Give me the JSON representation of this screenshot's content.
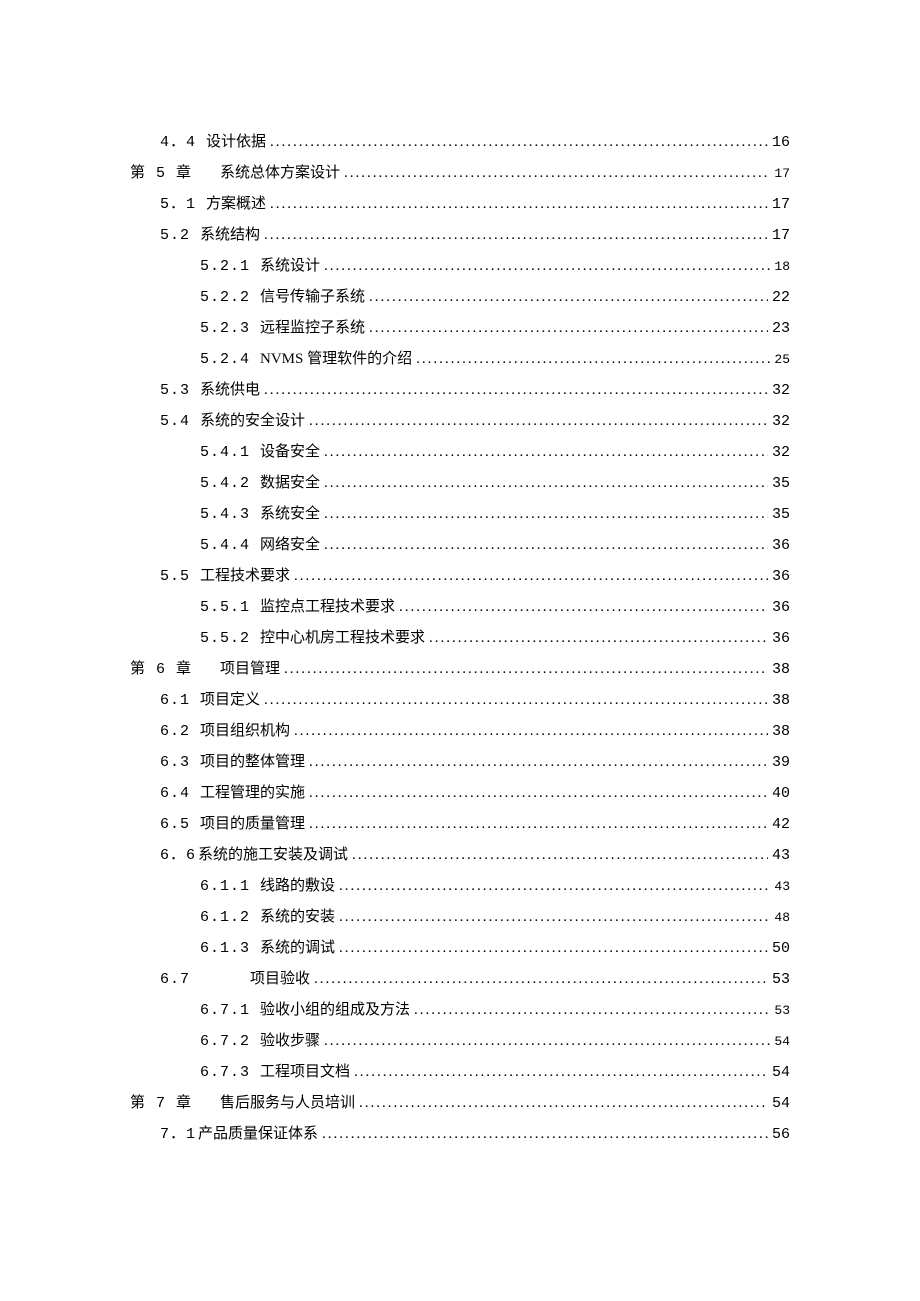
{
  "toc": [
    {
      "indent": "L1b",
      "num": "4．4",
      "title": "设计依据",
      "page": "16",
      "pageClass": ""
    },
    {
      "indent": "L0",
      "num": "第 5 章",
      "title": "系统总体方案设计",
      "page": "17",
      "pageClass": "smallpage",
      "titlePad": true
    },
    {
      "indent": "L1",
      "num": "5．1",
      "title": "方案概述",
      "page": "17",
      "pageClass": ""
    },
    {
      "indent": "L1",
      "num": "5.2",
      "title": "系统结构",
      "page": "17",
      "pageClass": ""
    },
    {
      "indent": "L2",
      "num": "5.2.1",
      "title": "系统设计",
      "page": "18",
      "pageClass": "smallpage"
    },
    {
      "indent": "L2",
      "num": "5.2.2",
      "title": "信号传输子系统",
      "page": "22",
      "pageClass": ""
    },
    {
      "indent": "L2",
      "num": "5.2.3",
      "title": "远程监控子系统",
      "page": "23",
      "pageClass": ""
    },
    {
      "indent": "L2",
      "num": "5.2.4",
      "title": "NVMS 管理软件的介绍",
      "page": "25",
      "pageClass": "smallpage"
    },
    {
      "indent": "L1",
      "num": "5.3",
      "title": "系统供电",
      "page": "32",
      "pageClass": ""
    },
    {
      "indent": "L1",
      "num": "5.4",
      "title": "系统的安全设计",
      "page": "32",
      "pageClass": ""
    },
    {
      "indent": "L2",
      "num": "5.4.1",
      "title": "设备安全",
      "page": "32",
      "pageClass": ""
    },
    {
      "indent": "L2",
      "num": "5.4.2",
      "title": "数据安全",
      "page": "35",
      "pageClass": ""
    },
    {
      "indent": "L2",
      "num": "5.4.3",
      "title": "系统安全",
      "page": "35",
      "pageClass": ""
    },
    {
      "indent": "L2",
      "num": "5.4.4",
      "title": "网络安全",
      "page": "36",
      "pageClass": ""
    },
    {
      "indent": "L1",
      "num": "5.5",
      "title": "工程技术要求",
      "page": "36",
      "pageClass": ""
    },
    {
      "indent": "L2",
      "num": "5.5.1",
      "title": "监控点工程技术要求",
      "page": "36",
      "pageClass": ""
    },
    {
      "indent": "L2",
      "num": "5.5.2",
      "title": "控中心机房工程技术要求",
      "page": "36",
      "pageClass": ""
    },
    {
      "indent": "L0",
      "num": "第 6 章",
      "title": "项目管理",
      "page": "38",
      "pageClass": "",
      "titlePad": true
    },
    {
      "indent": "L1",
      "num": "6.1",
      "title": "项目定义",
      "page": "38",
      "pageClass": ""
    },
    {
      "indent": "L1",
      "num": "6.2",
      "title": "项目组织机构",
      "page": "38",
      "pageClass": ""
    },
    {
      "indent": "L1",
      "num": "6.3",
      "title": "项目的整体管理",
      "page": "39",
      "pageClass": ""
    },
    {
      "indent": "L1",
      "num": "6.4",
      "title": "工程管理的实施",
      "page": "40",
      "pageClass": ""
    },
    {
      "indent": "L1",
      "num": "6.5",
      "title": "项目的质量管理",
      "page": "42",
      "pageClass": ""
    },
    {
      "indent": "L1",
      "num": "6．6",
      "title": "系统的施工安装及调试",
      "page": "43",
      "pageClass": "",
      "noTitleGap": true
    },
    {
      "indent": "L2",
      "num": "6.1.1",
      "title": "线路的敷设",
      "page": "43",
      "pageClass": "smallpage"
    },
    {
      "indent": "L2",
      "num": "6.1.2",
      "title": "系统的安装",
      "page": "48",
      "pageClass": "smallpage"
    },
    {
      "indent": "L2",
      "num": "6.1.3",
      "title": "系统的调试",
      "page": "50",
      "pageClass": ""
    },
    {
      "indent": "L1",
      "num": "6.7",
      "title": "项目验收",
      "page": "53",
      "pageClass": "",
      "titlePad": true,
      "extraPad": true
    },
    {
      "indent": "L2",
      "num": "6.7.1",
      "title": "验收小组的组成及方法",
      "page": "53",
      "pageClass": "smallpage"
    },
    {
      "indent": "L2",
      "num": "6.7.2",
      "title": "验收步骤",
      "page": "54",
      "pageClass": "smallpage"
    },
    {
      "indent": "L2",
      "num": "6.7.3",
      "title": "工程项目文档",
      "page": "54",
      "pageClass": ""
    },
    {
      "indent": "L0",
      "num": "第 7 章",
      "title": "售后服务与人员培训",
      "page": "54",
      "pageClass": "",
      "titlePad": true
    },
    {
      "indent": "L1",
      "num": "7．1",
      "title": "产品质量保证体系",
      "page": "56",
      "pageClass": "",
      "noTitleGap": true
    }
  ],
  "dots": "..................................................................................................................................."
}
